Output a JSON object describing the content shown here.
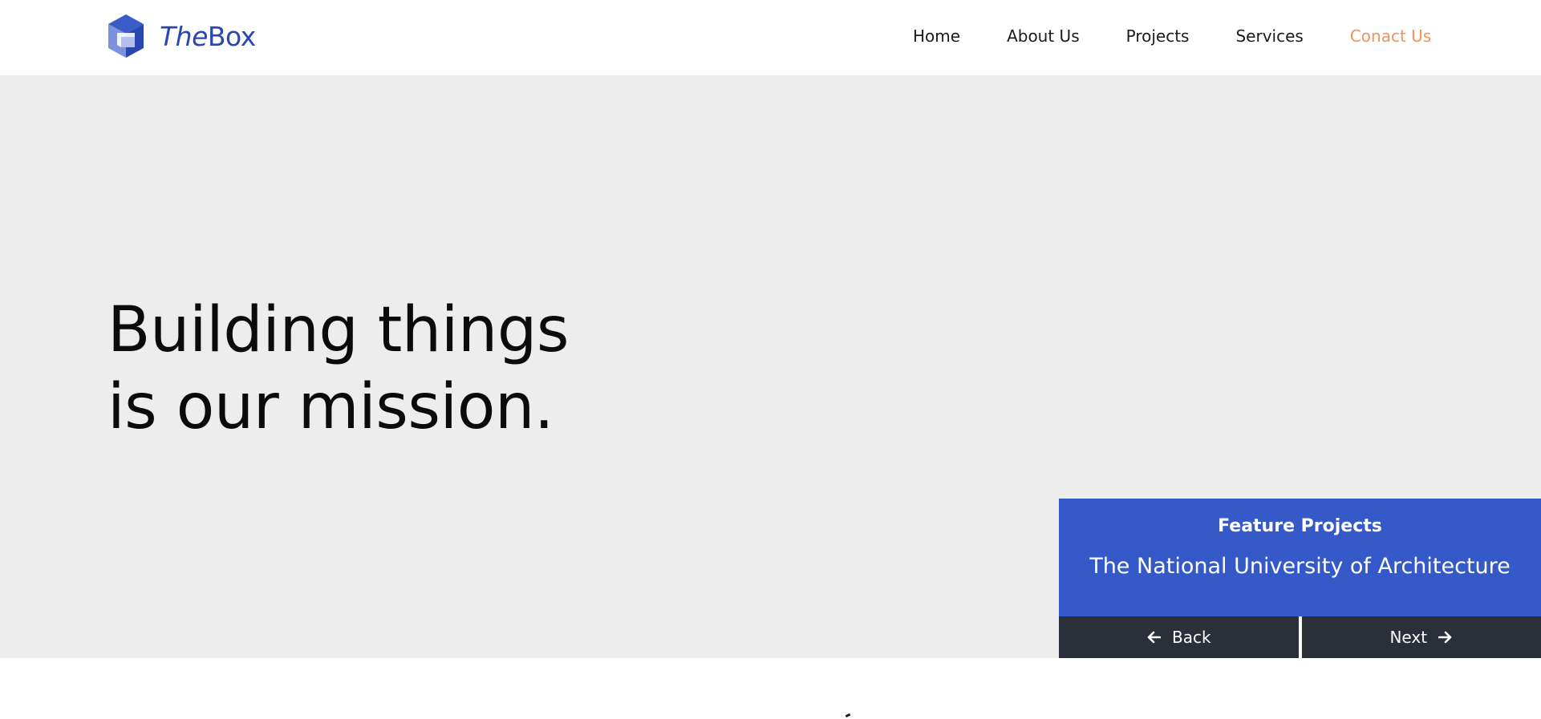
{
  "brand": {
    "name_prefix": "The",
    "name_suffix": "Box",
    "logo_icon": "cube-icon",
    "color": "#2a46b0"
  },
  "nav": {
    "items": [
      {
        "label": "Home"
      },
      {
        "label": "About Us"
      },
      {
        "label": "Projects"
      },
      {
        "label": "Services"
      },
      {
        "label": "Conact Us",
        "accent": true
      }
    ],
    "accent_color": "#f0945b"
  },
  "hero": {
    "headline_line1": "Building things",
    "headline_line2": "is our mission.",
    "background": "#ededed"
  },
  "feature": {
    "label": "Feature Projects",
    "title": "The National University of Architecture",
    "back_label": "Back",
    "next_label": "Next",
    "back_icon": "arrow-left-icon",
    "next_icon": "arrow-right-icon",
    "panel_color": "#3659c9",
    "button_color": "#2a2f3a"
  }
}
